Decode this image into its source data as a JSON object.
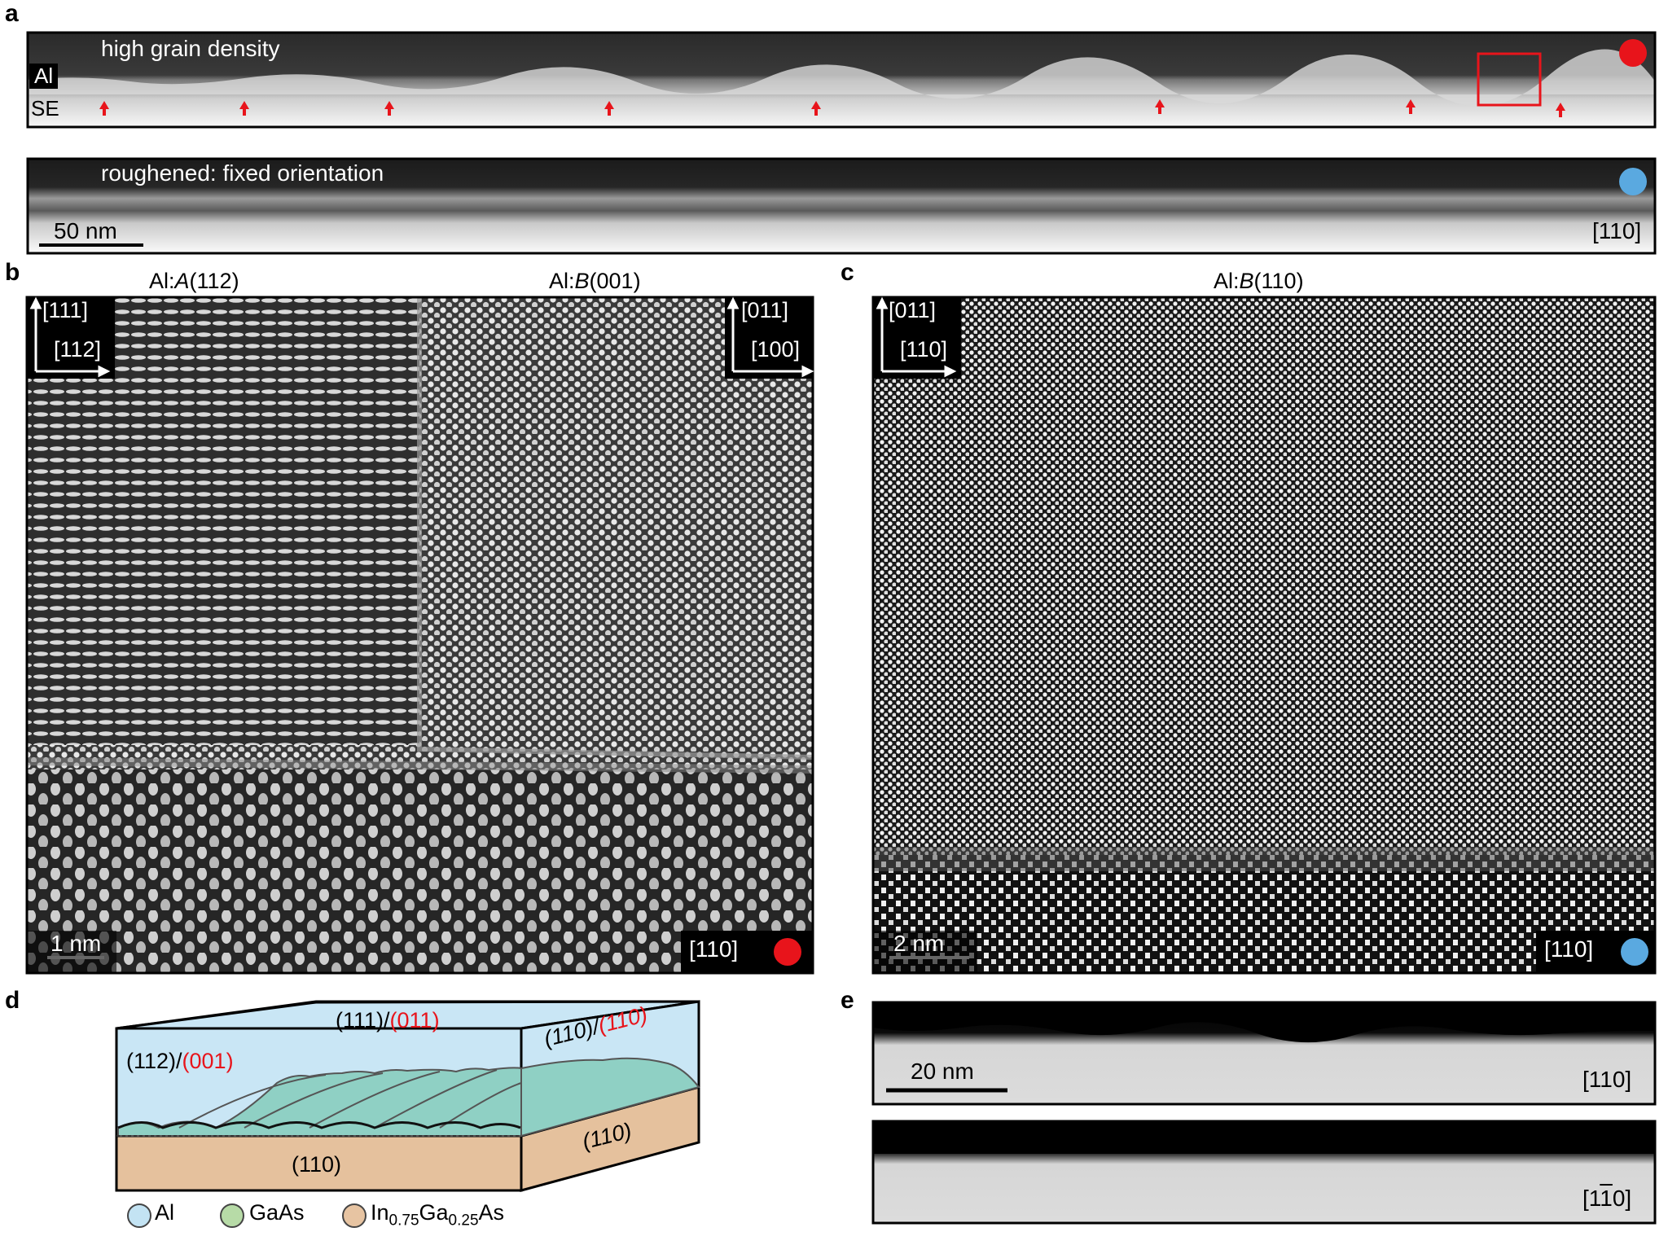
{
  "panels": {
    "a": "a",
    "b": "b",
    "c": "c",
    "d": "d",
    "e": "e"
  },
  "a": {
    "top_caption": "high grain density",
    "label_al": "Al",
    "label_se": "SE",
    "bottom_caption": "roughened: fixed orientation",
    "scale": "50 nm",
    "direction": "[110]",
    "top_dot_color": "#e8141b",
    "bottom_dot_color": "#5aa9e0"
  },
  "b": {
    "title_left": "Al:",
    "title_left_italic": "A",
    "title_left_rest": "(112)",
    "title_right": "Al:",
    "title_right_italic": "B",
    "title_right_rest": "(001)",
    "axes_left_up": "[111]",
    "axes_left_right": "[112]",
    "axes_right_up": "[011]",
    "axes_right_right": "[100]",
    "scale": "1 nm",
    "direction": "[110]",
    "dot_color": "#e8141b"
  },
  "c": {
    "title": "Al:",
    "title_italic": "B",
    "title_rest": "(110)",
    "axes_up": "[011]",
    "axes_right": "[110]",
    "scale": "2 nm",
    "direction": "[110]",
    "dot_color": "#5aa9e0"
  },
  "d": {
    "top_face_black": "(111)/",
    "top_face_red": "(011)",
    "front_face_black": "(112)/",
    "front_face_red": "(001)",
    "side_face_black": "(110)/",
    "side_face_red": "(110)",
    "substrate_front": "(110)",
    "substrate_side": "(110)",
    "legend": [
      {
        "label": "Al",
        "color": "#c3e3f3"
      },
      {
        "label": "GaAs",
        "color": "#b7dba7"
      },
      {
        "label_main": "In",
        "sub1": "0.75",
        "mid": "Ga",
        "sub2": "0.25",
        "end": "As",
        "color": "#e7c4a2"
      }
    ],
    "al_color": "#c9e6f5",
    "film_color": "#8fd0c4",
    "substrate_color": "#e5c19d",
    "red_text_color": "#e8141b"
  },
  "e": {
    "scale": "20 nm",
    "direction_top": "[110]",
    "direction_bottom_pre": "[1",
    "direction_bottom_bar": "1",
    "direction_bottom_post": "0]"
  }
}
